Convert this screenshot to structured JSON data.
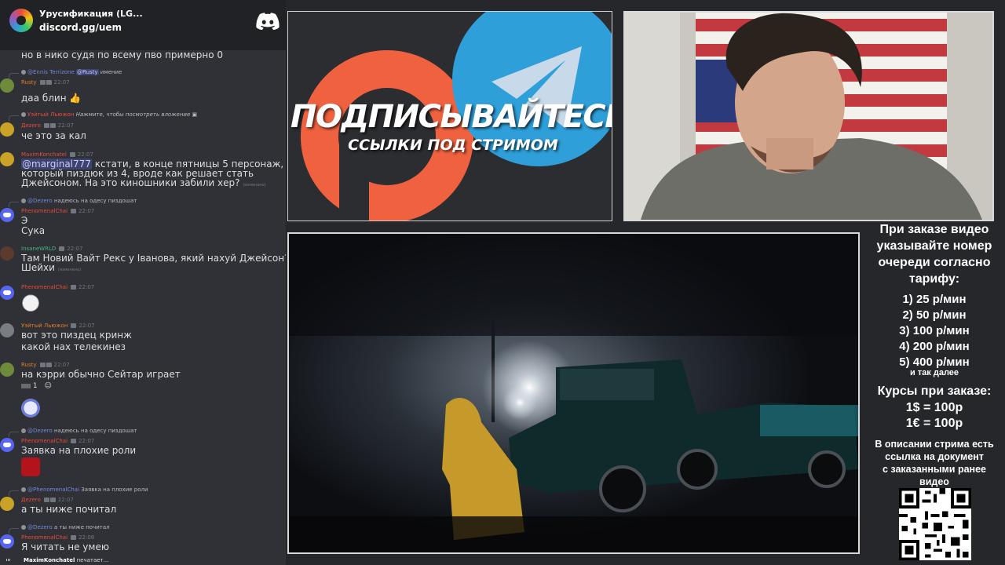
{
  "discord": {
    "server_name": "Урусификация (LG...",
    "server_link": "discord.gg/uem",
    "messages": [
      {
        "text": "но в нико судя по всему пво примерно 0"
      },
      {
        "reply": "@Ennis Terrizone",
        "reply_mention": "@Rusty",
        "reply_tail": "имение",
        "user": "Rusty",
        "time": "22:07",
        "text": "даа блин"
      },
      {
        "reply": "Уэйтый Льюжон",
        "reply_tail": "Нажмите, чтобы посмотреть вложение",
        "user": "Дezero",
        "time": "22:07",
        "text": "че это за кал"
      },
      {
        "user": "MaximKonchatel",
        "time": "22:07",
        "mention": "@marginal777",
        "text1": " кстати, в конце пятницы 5 персонаж,",
        "text2": "который пиздюк из 4, вроде как решает стать",
        "text3": "Джейсоном. На это киношники забили хер?",
        "edited": "(изменено)"
      },
      {
        "reply": "@Dezero",
        "reply_tail": "надеюсь на одесу пиздошат",
        "user": "PhenomenalChai",
        "time": "22:07",
        "text1": "Э",
        "text2": "Сука"
      },
      {
        "user": "InsaneWRLD",
        "time": "22:07",
        "text1": "Там Новий Вайт Рекс  у Іванова, який нахуй Джейсон?",
        "text2": "Шейхи",
        "edited": "(изменено)"
      },
      {
        "user": "PhenomenalChai",
        "time": "22:07"
      },
      {
        "user": "Уэйтый Льюжон",
        "time": "22:07",
        "text1": "вот это пиздец кринж",
        "text2": "какой нах телекинез"
      },
      {
        "user": "Rusty",
        "time": "22:07",
        "text": "на кэрри обычно Сейтар играет",
        "reaction": "1"
      },
      {
        "reply": "@Dezero",
        "reply_tail": "надеюсь на одесу пиздошат",
        "user": "PhenomenalChai",
        "time": "22:07",
        "text": "Заявка на плохие роли"
      },
      {
        "reply": "@PhenomenalChai",
        "reply_tail": "Заявка на плохие роли",
        "user": "Дezero",
        "time": "22:07",
        "text": "а ты ниже почитал"
      },
      {
        "reply": "@Dezero",
        "reply_tail": "а ты ниже почитал",
        "user": "PhenomenalChai",
        "time": "22:08",
        "text": "Я читать не умею"
      }
    ],
    "typing_user": "MaximKonchatel",
    "typing_suffix": "печатает..."
  },
  "banner": {
    "title": "ПОДПИСЫВАЙТЕСЬ",
    "subtitle": "ССЫЛКИ ПОД СТРИМОМ"
  },
  "info": {
    "line1": "При заказе видео",
    "line2": "указывайте номер",
    "line3": "очереди согласно",
    "line4": "тарифу:",
    "tariffs": [
      "1) 25 р/мин",
      "2) 50 р/мин",
      "3) 100 р/мин",
      "4) 200 р/мин",
      "5) 400 р/мин"
    ],
    "tariff_more": "и так далее",
    "courses_title": "Курсы при заказе:",
    "rate_usd": "1$ = 100р",
    "rate_eur": "1€ = 100р",
    "desc1": "В описании стрима есть",
    "desc2": "ссылка на документ",
    "desc3": "с заказанными ранее",
    "desc4": "видео"
  },
  "colors": {
    "telegram": "#2e9fd9",
    "patreon": "#f0623f",
    "discord_bg": "#2f3136"
  }
}
